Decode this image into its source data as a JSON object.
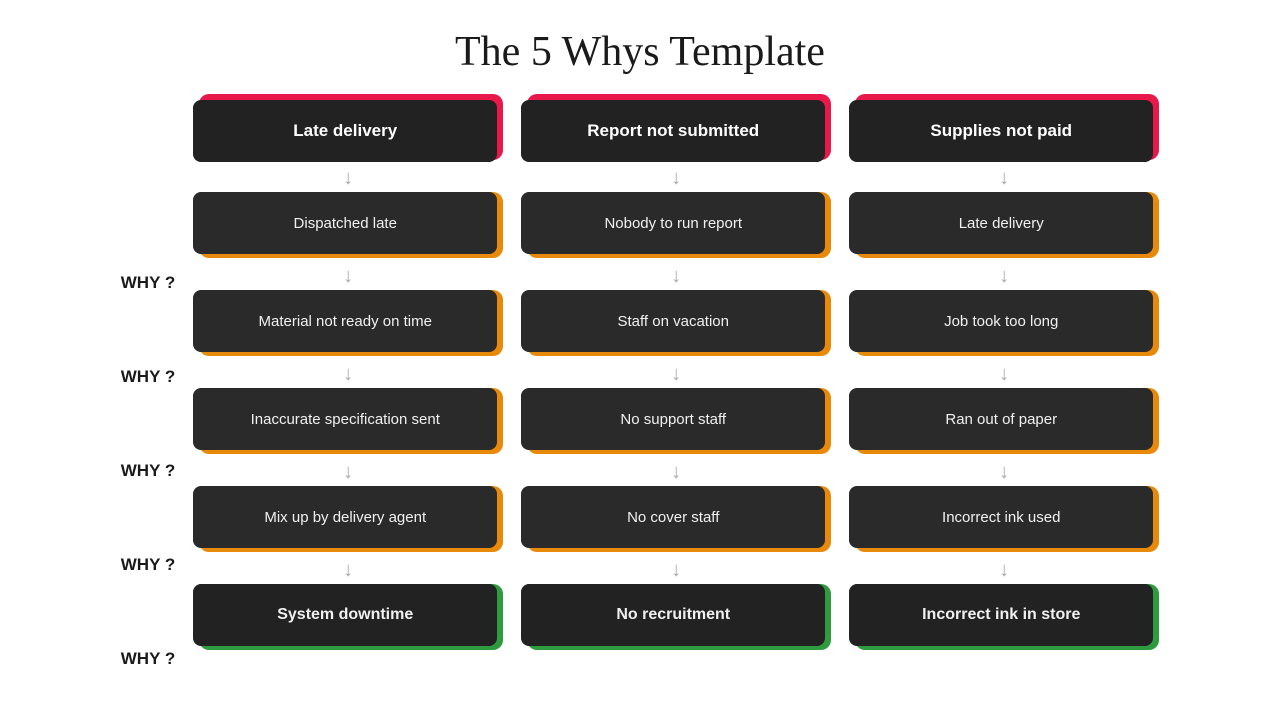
{
  "title": "The 5 Whys Template",
  "why_labels": [
    "WHY ?",
    "WHY ?",
    "WHY ?",
    "WHY ?",
    "WHY ?"
  ],
  "columns": [
    {
      "header": "Late delivery",
      "header_color": "red",
      "rows": [
        {
          "text": "Dispatched late",
          "color": "orange"
        },
        {
          "text": "Material not ready on time",
          "color": "orange"
        },
        {
          "text": "Inaccurate specification sent",
          "color": "orange"
        },
        {
          "text": "Mix up by delivery agent",
          "color": "orange"
        },
        {
          "text": "System downtime",
          "color": "green",
          "bold": true
        }
      ]
    },
    {
      "header": "Report not submitted",
      "header_color": "red",
      "rows": [
        {
          "text": "Nobody to run report",
          "color": "orange"
        },
        {
          "text": "Staff on vacation",
          "color": "orange"
        },
        {
          "text": "No support staff",
          "color": "orange"
        },
        {
          "text": "No cover staff",
          "color": "orange"
        },
        {
          "text": "No recruitment",
          "color": "green",
          "bold": true
        }
      ]
    },
    {
      "header": "Supplies not paid",
      "header_color": "red",
      "rows": [
        {
          "text": "Late delivery",
          "color": "orange"
        },
        {
          "text": "Job took too long",
          "color": "orange"
        },
        {
          "text": "Ran out of paper",
          "color": "orange"
        },
        {
          "text": "Incorrect ink used",
          "color": "orange"
        },
        {
          "text": "Incorrect ink in store",
          "color": "green",
          "bold": true
        }
      ]
    }
  ]
}
